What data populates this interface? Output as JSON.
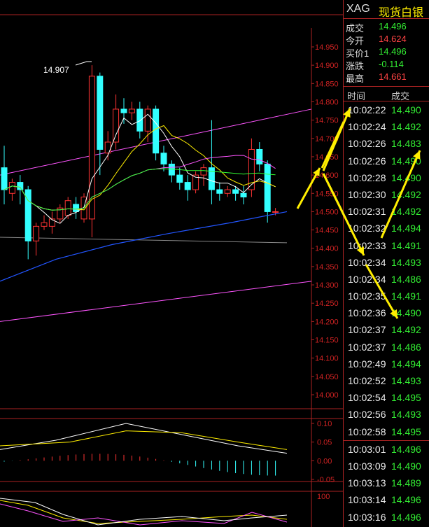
{
  "header": {
    "symbol": "XAG",
    "name": "现货白银"
  },
  "info": [
    {
      "label": "成交",
      "value": "14.496",
      "color": "#33ee33"
    },
    {
      "label": "今开",
      "value": "14.624",
      "color": "#ff4444"
    },
    {
      "label": "买价1",
      "value": "14.496",
      "color": "#33ee33"
    },
    {
      "label": "涨跌",
      "value": "-0.114",
      "color": "#33ee33"
    },
    {
      "label": "最高",
      "value": "14.661",
      "color": "#ff4444"
    }
  ],
  "trades_header": {
    "time": "时间",
    "price": "成交"
  },
  "trades": [
    {
      "time": "10:02:22",
      "price": "14.490"
    },
    {
      "time": "10:02:24",
      "price": "14.492"
    },
    {
      "time": "10:02:26",
      "price": "14.483"
    },
    {
      "time": "10:02:26",
      "price": "14.490"
    },
    {
      "time": "10:02:28",
      "price": "14.490"
    },
    {
      "time": "10:02:30",
      "price": "14.492"
    },
    {
      "time": "10:02:31",
      "price": "14.492"
    },
    {
      "time": "10:02:32",
      "price": "14.494"
    },
    {
      "time": "10:02:33",
      "price": "14.491"
    },
    {
      "time": "10:02:34",
      "price": "14.493"
    },
    {
      "time": "10:02:34",
      "price": "14.486"
    },
    {
      "time": "10:02:35",
      "price": "14.491"
    },
    {
      "time": "10:02:36",
      "price": "14.490"
    },
    {
      "time": "10:02:37",
      "price": "14.492"
    },
    {
      "time": "10:02:37",
      "price": "14.486"
    },
    {
      "time": "10:02:49",
      "price": "14.494"
    },
    {
      "time": "10:02:52",
      "price": "14.493"
    },
    {
      "time": "10:02:54",
      "price": "14.495"
    },
    {
      "time": "10:02:56",
      "price": "14.493"
    },
    {
      "time": "10:02:58",
      "price": "14.495"
    },
    {
      "time": "10:03:01",
      "price": "14.496"
    },
    {
      "time": "10:03:09",
      "price": "14.490"
    },
    {
      "time": "10:03:13",
      "price": "14.489"
    },
    {
      "time": "10:03:14",
      "price": "14.496"
    },
    {
      "time": "10:03:16",
      "price": "14.496"
    }
  ],
  "chart_data": {
    "type": "candlestick",
    "price_ticks": [
      "14.950",
      "14.900",
      "14.850",
      "14.800",
      "14.750",
      "14.700",
      "14.650",
      "14.600",
      "14.550",
      "14.500",
      "14.450",
      "14.400",
      "14.350",
      "14.300",
      "14.250",
      "14.200",
      "14.150",
      "14.100",
      "14.050",
      "14.000"
    ],
    "ylim": [
      14.0,
      14.95
    ],
    "high_annotation": "14.907",
    "candles": [
      [
        14.62,
        14.56,
        14.68,
        14.52
      ],
      [
        14.55,
        14.58,
        14.59,
        14.53
      ],
      [
        14.58,
        14.56,
        14.6,
        14.52
      ],
      [
        14.56,
        14.42,
        14.57,
        14.37
      ],
      [
        14.42,
        14.46,
        14.47,
        14.38
      ],
      [
        14.46,
        14.47,
        14.49,
        14.45
      ],
      [
        14.46,
        14.48,
        14.5,
        14.44
      ],
      [
        14.48,
        14.51,
        14.52,
        14.47
      ],
      [
        14.49,
        14.53,
        14.54,
        14.48
      ],
      [
        14.52,
        14.5,
        14.54,
        14.48
      ],
      [
        14.48,
        14.54,
        14.55,
        14.47
      ],
      [
        14.48,
        14.87,
        14.9,
        14.43
      ],
      [
        14.87,
        14.67,
        14.88,
        14.6
      ],
      [
        14.66,
        14.69,
        14.72,
        14.64
      ],
      [
        14.69,
        14.78,
        14.82,
        14.67
      ],
      [
        14.78,
        14.77,
        14.81,
        14.74
      ],
      [
        14.77,
        14.78,
        14.8,
        14.75
      ],
      [
        14.78,
        14.72,
        14.8,
        14.7
      ],
      [
        14.72,
        14.78,
        14.79,
        14.69
      ],
      [
        14.78,
        14.66,
        14.79,
        14.64
      ],
      [
        14.66,
        14.63,
        14.68,
        14.61
      ],
      [
        14.63,
        14.6,
        14.64,
        14.58
      ],
      [
        14.6,
        14.58,
        14.62,
        14.56
      ],
      [
        14.58,
        14.56,
        14.6,
        14.53
      ],
      [
        14.56,
        14.6,
        14.61,
        14.55
      ],
      [
        14.6,
        14.62,
        14.63,
        14.57
      ],
      [
        14.62,
        14.56,
        14.75,
        14.52
      ],
      [
        14.56,
        14.55,
        14.58,
        14.53
      ],
      [
        14.55,
        14.56,
        14.57,
        14.54
      ],
      [
        14.56,
        14.55,
        14.57,
        14.53
      ],
      [
        14.55,
        14.54,
        14.57,
        14.52
      ],
      [
        14.56,
        14.67,
        14.7,
        14.54
      ],
      [
        14.67,
        14.63,
        14.69,
        14.61
      ],
      [
        14.63,
        14.5,
        14.64,
        14.47
      ],
      [
        14.5,
        14.5,
        14.51,
        14.49
      ]
    ],
    "macd_ticks": [
      "0.10",
      "0.05",
      "0.00",
      "-0.05"
    ],
    "macd_ylim": [
      -0.05,
      0.1
    ],
    "kdj_ticks": [
      "100"
    ]
  },
  "colors": {
    "up": "#ff3333",
    "down": "#33ffff",
    "axis": "#aa2222",
    "grid": "#661111",
    "yellow": "#ffee00",
    "tick": "#cc2222"
  }
}
